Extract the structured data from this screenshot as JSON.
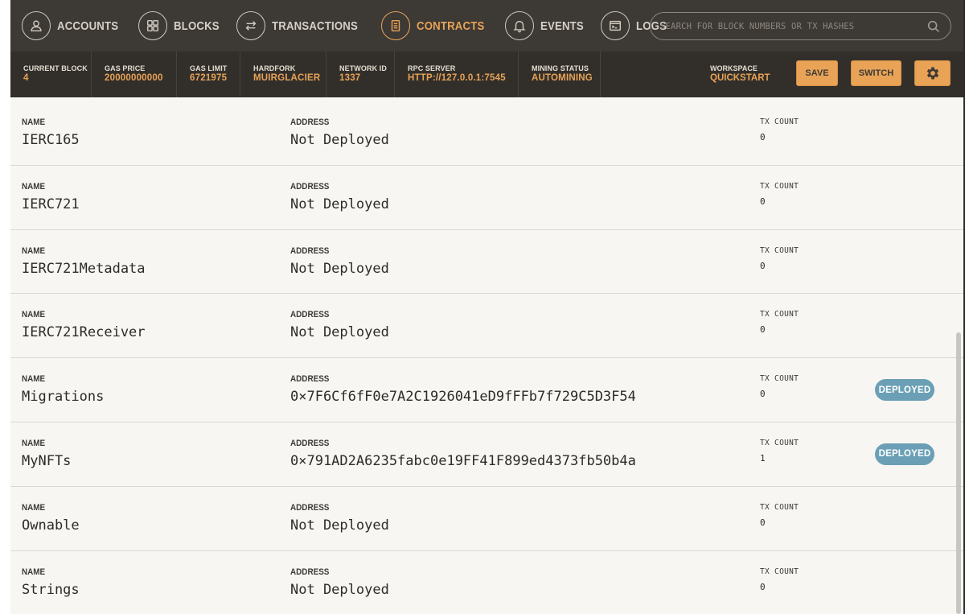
{
  "nav": {
    "items": [
      {
        "label": "ACCOUNTS",
        "icon": "person-icon",
        "active": false
      },
      {
        "label": "BLOCKS",
        "icon": "grid-icon",
        "active": false
      },
      {
        "label": "TRANSACTIONS",
        "icon": "arrows-icon",
        "active": false
      },
      {
        "label": "CONTRACTS",
        "icon": "document-icon",
        "active": true
      },
      {
        "label": "EVENTS",
        "icon": "bell-icon",
        "active": false
      },
      {
        "label": "LOGS",
        "icon": "terminal-icon",
        "active": false
      }
    ],
    "search_placeholder": "SEARCH FOR BLOCK NUMBERS OR TX HASHES"
  },
  "status": {
    "current_block": {
      "label": "CURRENT BLOCK",
      "value": "4"
    },
    "gas_price": {
      "label": "GAS PRICE",
      "value": "20000000000"
    },
    "gas_limit": {
      "label": "GAS LIMIT",
      "value": "6721975"
    },
    "hardfork": {
      "label": "HARDFORK",
      "value": "MUIRGLACIER"
    },
    "network_id": {
      "label": "NETWORK ID",
      "value": "1337"
    },
    "rpc_server": {
      "label": "RPC SERVER",
      "value": "HTTP://127.0.0.1:7545"
    },
    "mining_status": {
      "label": "MINING STATUS",
      "value": "AUTOMINING"
    },
    "workspace": {
      "label": "WORKSPACE",
      "value": "QUICKSTART"
    },
    "save_label": "SAVE",
    "switch_label": "SWITCH"
  },
  "labels": {
    "name": "NAME",
    "address": "ADDRESS",
    "tx_count": "TX COUNT"
  },
  "contracts": [
    {
      "name": "IERC165",
      "address": "Not Deployed",
      "tx_count": "0",
      "badge": ""
    },
    {
      "name": "IERC721",
      "address": "Not Deployed",
      "tx_count": "0",
      "badge": ""
    },
    {
      "name": "IERC721Metadata",
      "address": "Not Deployed",
      "tx_count": "0",
      "badge": ""
    },
    {
      "name": "IERC721Receiver",
      "address": "Not Deployed",
      "tx_count": "0",
      "badge": ""
    },
    {
      "name": "Migrations",
      "address": "0×7F6Cf6fF0e7A2C1926041eD9fFFb7f729C5D3F54",
      "tx_count": "0",
      "badge": "DEPLOYED"
    },
    {
      "name": "MyNFTs",
      "address": "0×791AD2A6235fabc0e19FF41F899ed4373fb50b4a",
      "tx_count": "1",
      "badge": "DEPLOYED"
    },
    {
      "name": "Ownable",
      "address": "Not Deployed",
      "tx_count": "0",
      "badge": ""
    },
    {
      "name": "Strings",
      "address": "Not Deployed",
      "tx_count": "0",
      "badge": ""
    }
  ],
  "colors": {
    "accent": "#e8a357",
    "nav_bg": "#3d3935",
    "status_bg": "#322f2b",
    "badge": "#6a9fb5"
  }
}
